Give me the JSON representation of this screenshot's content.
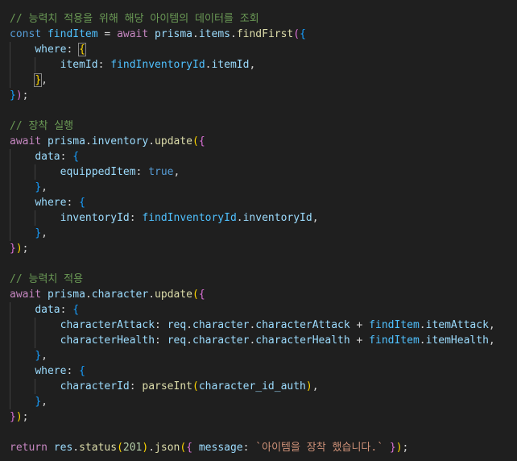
{
  "editor": {
    "colors": {
      "background": "#1f1f1f",
      "comment": "#6a9955",
      "keyword": "#569cd6",
      "control": "#c586c0",
      "variable": "#9cdcfe",
      "constant": "#4fc1ff",
      "function": "#dcdcaa",
      "number": "#b5cea8",
      "string": "#ce9178",
      "bracket_1": "#ffd700",
      "bracket_2": "#da70d6",
      "bracket_3": "#179fff",
      "plain": "#d4d4d4"
    },
    "lines": [
      [
        [
          "c",
          "// 능력치 적용을 위해 해당 아이템의 데이터를 조회"
        ]
      ],
      [
        [
          "k",
          "const"
        ],
        [
          "p",
          " "
        ],
        [
          "n",
          "findItem"
        ],
        [
          "p",
          " = "
        ],
        [
          "x",
          "await"
        ],
        [
          "p",
          " "
        ],
        [
          "v",
          "prisma"
        ],
        [
          "p",
          "."
        ],
        [
          "v",
          "items"
        ],
        [
          "p",
          "."
        ],
        [
          "f",
          "findFirst"
        ],
        [
          "b2",
          "("
        ],
        [
          "b3",
          "{"
        ]
      ],
      [
        [
          "p",
          "    "
        ],
        [
          "v",
          "where"
        ],
        [
          "p",
          ": "
        ],
        [
          "b1",
          "{"
        ]
      ],
      [
        [
          "p",
          "        "
        ],
        [
          "v",
          "itemId"
        ],
        [
          "p",
          ": "
        ],
        [
          "n",
          "findInventoryId"
        ],
        [
          "p",
          "."
        ],
        [
          "v",
          "itemId"
        ],
        [
          "p",
          ","
        ]
      ],
      [
        [
          "p",
          "    "
        ],
        [
          "b1",
          "}"
        ],
        [
          "p",
          ","
        ]
      ],
      [
        [
          "b3",
          "}"
        ],
        [
          "b2",
          ")"
        ],
        [
          "p",
          ";"
        ]
      ],
      [],
      [
        [
          "c",
          "// 장착 실행"
        ]
      ],
      [
        [
          "x",
          "await"
        ],
        [
          "p",
          " "
        ],
        [
          "v",
          "prisma"
        ],
        [
          "p",
          "."
        ],
        [
          "v",
          "inventory"
        ],
        [
          "p",
          "."
        ],
        [
          "f",
          "update"
        ],
        [
          "b1",
          "("
        ],
        [
          "b2",
          "{"
        ]
      ],
      [
        [
          "p",
          "    "
        ],
        [
          "v",
          "data"
        ],
        [
          "p",
          ": "
        ],
        [
          "b3",
          "{"
        ]
      ],
      [
        [
          "p",
          "        "
        ],
        [
          "v",
          "equippedItem"
        ],
        [
          "p",
          ": "
        ],
        [
          "k",
          "true"
        ],
        [
          "p",
          ","
        ]
      ],
      [
        [
          "p",
          "    "
        ],
        [
          "b3",
          "}"
        ],
        [
          "p",
          ","
        ]
      ],
      [
        [
          "p",
          "    "
        ],
        [
          "v",
          "where"
        ],
        [
          "p",
          ": "
        ],
        [
          "b3",
          "{"
        ]
      ],
      [
        [
          "p",
          "        "
        ],
        [
          "v",
          "inventoryId"
        ],
        [
          "p",
          ": "
        ],
        [
          "n",
          "findInventoryId"
        ],
        [
          "p",
          "."
        ],
        [
          "v",
          "inventoryId"
        ],
        [
          "p",
          ","
        ]
      ],
      [
        [
          "p",
          "    "
        ],
        [
          "b3",
          "}"
        ],
        [
          "p",
          ","
        ]
      ],
      [
        [
          "b2",
          "}"
        ],
        [
          "b1",
          ")"
        ],
        [
          "p",
          ";"
        ]
      ],
      [],
      [
        [
          "c",
          "// 능력치 적용"
        ]
      ],
      [
        [
          "x",
          "await"
        ],
        [
          "p",
          " "
        ],
        [
          "v",
          "prisma"
        ],
        [
          "p",
          "."
        ],
        [
          "v",
          "character"
        ],
        [
          "p",
          "."
        ],
        [
          "f",
          "update"
        ],
        [
          "b1",
          "("
        ],
        [
          "b2",
          "{"
        ]
      ],
      [
        [
          "p",
          "    "
        ],
        [
          "v",
          "data"
        ],
        [
          "p",
          ": "
        ],
        [
          "b3",
          "{"
        ]
      ],
      [
        [
          "p",
          "        "
        ],
        [
          "v",
          "characterAttack"
        ],
        [
          "p",
          ": "
        ],
        [
          "v",
          "req"
        ],
        [
          "p",
          "."
        ],
        [
          "v",
          "character"
        ],
        [
          "p",
          "."
        ],
        [
          "v",
          "characterAttack"
        ],
        [
          "p",
          " + "
        ],
        [
          "n",
          "findItem"
        ],
        [
          "p",
          "."
        ],
        [
          "v",
          "itemAttack"
        ],
        [
          "p",
          ","
        ]
      ],
      [
        [
          "p",
          "        "
        ],
        [
          "v",
          "characterHealth"
        ],
        [
          "p",
          ": "
        ],
        [
          "v",
          "req"
        ],
        [
          "p",
          "."
        ],
        [
          "v",
          "character"
        ],
        [
          "p",
          "."
        ],
        [
          "v",
          "characterHealth"
        ],
        [
          "p",
          " + "
        ],
        [
          "n",
          "findItem"
        ],
        [
          "p",
          "."
        ],
        [
          "v",
          "itemHealth"
        ],
        [
          "p",
          ","
        ]
      ],
      [
        [
          "p",
          "    "
        ],
        [
          "b3",
          "}"
        ],
        [
          "p",
          ","
        ]
      ],
      [
        [
          "p",
          "    "
        ],
        [
          "v",
          "where"
        ],
        [
          "p",
          ": "
        ],
        [
          "b3",
          "{"
        ]
      ],
      [
        [
          "p",
          "        "
        ],
        [
          "v",
          "characterId"
        ],
        [
          "p",
          ": "
        ],
        [
          "f",
          "parseInt"
        ],
        [
          "b1",
          "("
        ],
        [
          "v",
          "character_id_auth"
        ],
        [
          "b1",
          ")"
        ],
        [
          "p",
          ","
        ]
      ],
      [
        [
          "p",
          "    "
        ],
        [
          "b3",
          "}"
        ],
        [
          "p",
          ","
        ]
      ],
      [
        [
          "b2",
          "}"
        ],
        [
          "b1",
          ")"
        ],
        [
          "p",
          ";"
        ]
      ],
      [],
      [
        [
          "x",
          "return"
        ],
        [
          "p",
          " "
        ],
        [
          "v",
          "res"
        ],
        [
          "p",
          "."
        ],
        [
          "f",
          "status"
        ],
        [
          "b1",
          "("
        ],
        [
          "u",
          "201"
        ],
        [
          "b1",
          ")"
        ],
        [
          "p",
          "."
        ],
        [
          "f",
          "json"
        ],
        [
          "b1",
          "("
        ],
        [
          "b2",
          "{"
        ],
        [
          "p",
          " "
        ],
        [
          "v",
          "message"
        ],
        [
          "p",
          ": "
        ],
        [
          "s",
          "`아이템을 장착 했습니다.`"
        ],
        [
          "p",
          " "
        ],
        [
          "b2",
          "}"
        ],
        [
          "b1",
          ")"
        ],
        [
          "p",
          ";"
        ]
      ]
    ]
  }
}
